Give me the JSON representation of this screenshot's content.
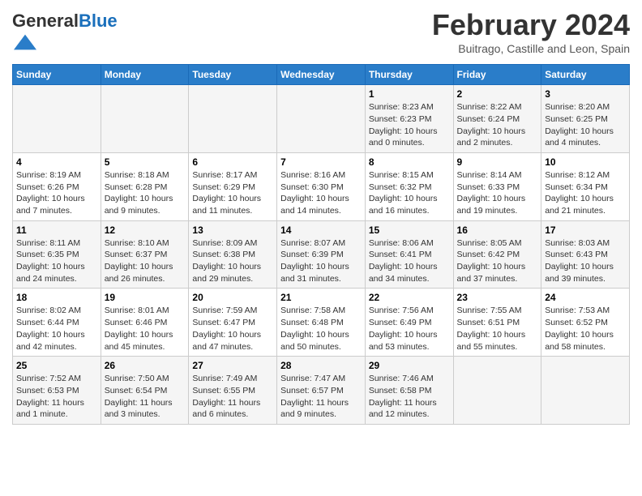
{
  "header": {
    "logo_general": "General",
    "logo_blue": "Blue",
    "month": "February 2024",
    "location": "Buitrago, Castille and Leon, Spain"
  },
  "days_of_week": [
    "Sunday",
    "Monday",
    "Tuesday",
    "Wednesday",
    "Thursday",
    "Friday",
    "Saturday"
  ],
  "weeks": [
    [
      {
        "day": "",
        "info": ""
      },
      {
        "day": "",
        "info": ""
      },
      {
        "day": "",
        "info": ""
      },
      {
        "day": "",
        "info": ""
      },
      {
        "day": "1",
        "info": "Sunrise: 8:23 AM\nSunset: 6:23 PM\nDaylight: 10 hours\nand 0 minutes."
      },
      {
        "day": "2",
        "info": "Sunrise: 8:22 AM\nSunset: 6:24 PM\nDaylight: 10 hours\nand 2 minutes."
      },
      {
        "day": "3",
        "info": "Sunrise: 8:20 AM\nSunset: 6:25 PM\nDaylight: 10 hours\nand 4 minutes."
      }
    ],
    [
      {
        "day": "4",
        "info": "Sunrise: 8:19 AM\nSunset: 6:26 PM\nDaylight: 10 hours\nand 7 minutes."
      },
      {
        "day": "5",
        "info": "Sunrise: 8:18 AM\nSunset: 6:28 PM\nDaylight: 10 hours\nand 9 minutes."
      },
      {
        "day": "6",
        "info": "Sunrise: 8:17 AM\nSunset: 6:29 PM\nDaylight: 10 hours\nand 11 minutes."
      },
      {
        "day": "7",
        "info": "Sunrise: 8:16 AM\nSunset: 6:30 PM\nDaylight: 10 hours\nand 14 minutes."
      },
      {
        "day": "8",
        "info": "Sunrise: 8:15 AM\nSunset: 6:32 PM\nDaylight: 10 hours\nand 16 minutes."
      },
      {
        "day": "9",
        "info": "Sunrise: 8:14 AM\nSunset: 6:33 PM\nDaylight: 10 hours\nand 19 minutes."
      },
      {
        "day": "10",
        "info": "Sunrise: 8:12 AM\nSunset: 6:34 PM\nDaylight: 10 hours\nand 21 minutes."
      }
    ],
    [
      {
        "day": "11",
        "info": "Sunrise: 8:11 AM\nSunset: 6:35 PM\nDaylight: 10 hours\nand 24 minutes."
      },
      {
        "day": "12",
        "info": "Sunrise: 8:10 AM\nSunset: 6:37 PM\nDaylight: 10 hours\nand 26 minutes."
      },
      {
        "day": "13",
        "info": "Sunrise: 8:09 AM\nSunset: 6:38 PM\nDaylight: 10 hours\nand 29 minutes."
      },
      {
        "day": "14",
        "info": "Sunrise: 8:07 AM\nSunset: 6:39 PM\nDaylight: 10 hours\nand 31 minutes."
      },
      {
        "day": "15",
        "info": "Sunrise: 8:06 AM\nSunset: 6:41 PM\nDaylight: 10 hours\nand 34 minutes."
      },
      {
        "day": "16",
        "info": "Sunrise: 8:05 AM\nSunset: 6:42 PM\nDaylight: 10 hours\nand 37 minutes."
      },
      {
        "day": "17",
        "info": "Sunrise: 8:03 AM\nSunset: 6:43 PM\nDaylight: 10 hours\nand 39 minutes."
      }
    ],
    [
      {
        "day": "18",
        "info": "Sunrise: 8:02 AM\nSunset: 6:44 PM\nDaylight: 10 hours\nand 42 minutes."
      },
      {
        "day": "19",
        "info": "Sunrise: 8:01 AM\nSunset: 6:46 PM\nDaylight: 10 hours\nand 45 minutes."
      },
      {
        "day": "20",
        "info": "Sunrise: 7:59 AM\nSunset: 6:47 PM\nDaylight: 10 hours\nand 47 minutes."
      },
      {
        "day": "21",
        "info": "Sunrise: 7:58 AM\nSunset: 6:48 PM\nDaylight: 10 hours\nand 50 minutes."
      },
      {
        "day": "22",
        "info": "Sunrise: 7:56 AM\nSunset: 6:49 PM\nDaylight: 10 hours\nand 53 minutes."
      },
      {
        "day": "23",
        "info": "Sunrise: 7:55 AM\nSunset: 6:51 PM\nDaylight: 10 hours\nand 55 minutes."
      },
      {
        "day": "24",
        "info": "Sunrise: 7:53 AM\nSunset: 6:52 PM\nDaylight: 10 hours\nand 58 minutes."
      }
    ],
    [
      {
        "day": "25",
        "info": "Sunrise: 7:52 AM\nSunset: 6:53 PM\nDaylight: 11 hours\nand 1 minute."
      },
      {
        "day": "26",
        "info": "Sunrise: 7:50 AM\nSunset: 6:54 PM\nDaylight: 11 hours\nand 3 minutes."
      },
      {
        "day": "27",
        "info": "Sunrise: 7:49 AM\nSunset: 6:55 PM\nDaylight: 11 hours\nand 6 minutes."
      },
      {
        "day": "28",
        "info": "Sunrise: 7:47 AM\nSunset: 6:57 PM\nDaylight: 11 hours\nand 9 minutes."
      },
      {
        "day": "29",
        "info": "Sunrise: 7:46 AM\nSunset: 6:58 PM\nDaylight: 11 hours\nand 12 minutes."
      },
      {
        "day": "",
        "info": ""
      },
      {
        "day": "",
        "info": ""
      }
    ]
  ]
}
